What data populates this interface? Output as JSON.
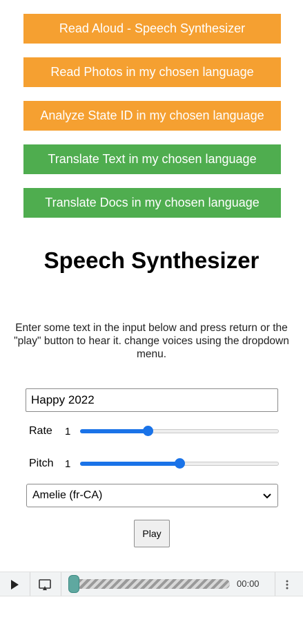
{
  "nav_buttons": [
    {
      "label": "Read Aloud - Speech Synthesizer",
      "color": "#f5a031"
    },
    {
      "label": "Read Photos in my chosen language",
      "color": "#f5a031"
    },
    {
      "label": "Analyze State ID in my chosen language",
      "color": "#f5a031"
    },
    {
      "label": "Translate Text in my chosen language",
      "color": "#4fad4f"
    },
    {
      "label": "Translate Docs in my chosen language",
      "color": "#4fad4f"
    }
  ],
  "title": "Speech Synthesizer",
  "description": "Enter some text in the input below and press return or the \"play\" button to hear it. change voices using the dropdown menu.",
  "text_input": {
    "value": "Happy 2022"
  },
  "rate": {
    "label": "Rate",
    "value": "1",
    "fraction": 0.34
  },
  "pitch": {
    "label": "Pitch",
    "value": "1",
    "fraction": 0.5
  },
  "voice_select": {
    "selected": "Amelie (fr-CA)"
  },
  "play_button": {
    "label": "Play"
  },
  "audio_player": {
    "time": "00:00",
    "progress_fraction": 0.0
  },
  "icons": {
    "player_play": "play-icon",
    "player_mirror": "cast-icon",
    "player_more": "more-vert-icon",
    "select_chevron": "chevron-down-icon"
  }
}
